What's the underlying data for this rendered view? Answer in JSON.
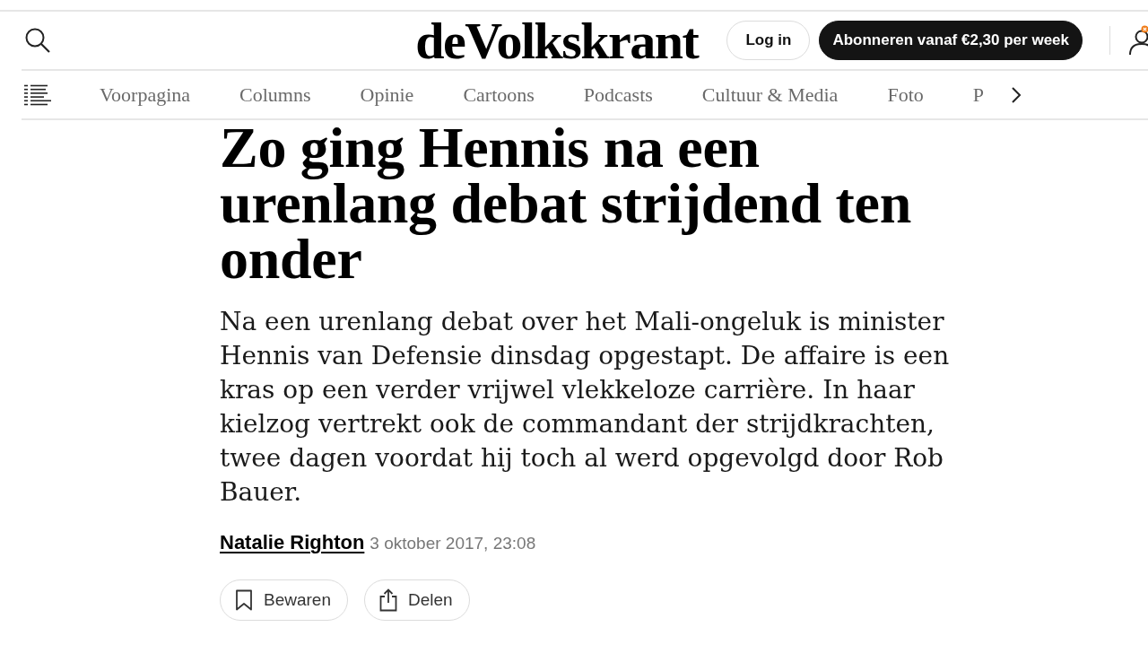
{
  "header": {
    "logo": "deVolkskrant",
    "login_button": "Log in",
    "subscribe_button": "Abonneren vanaf €2,30 per week"
  },
  "nav": {
    "items": [
      {
        "label": "Voorpagina"
      },
      {
        "label": "Columns"
      },
      {
        "label": "Opinie"
      },
      {
        "label": "Cartoons"
      },
      {
        "label": "Podcasts"
      },
      {
        "label": "Cultuur & Media"
      },
      {
        "label": "Foto"
      },
      {
        "label": "P"
      }
    ]
  },
  "article": {
    "headline": "Zo ging Hennis na een urenlang debat strijdend ten onder",
    "lead": "Na een urenlang debat over het Mali-ongeluk is minister Hennis van Defensie dinsdag opgestapt. De affaire is een kras op een verder vrijwel vlekkeloze carrière. In haar kielzog vertrekt ook de commandant der strijdkrachten, twee dagen voordat hij toch al werd opgevolgd door Rob Bauer.",
    "author": "Natalie Righton",
    "date": "3 oktober 2017, 23:08",
    "actions": [
      {
        "kind": "save",
        "label": "Bewaren"
      },
      {
        "kind": "share",
        "label": "Delen"
      }
    ]
  }
}
